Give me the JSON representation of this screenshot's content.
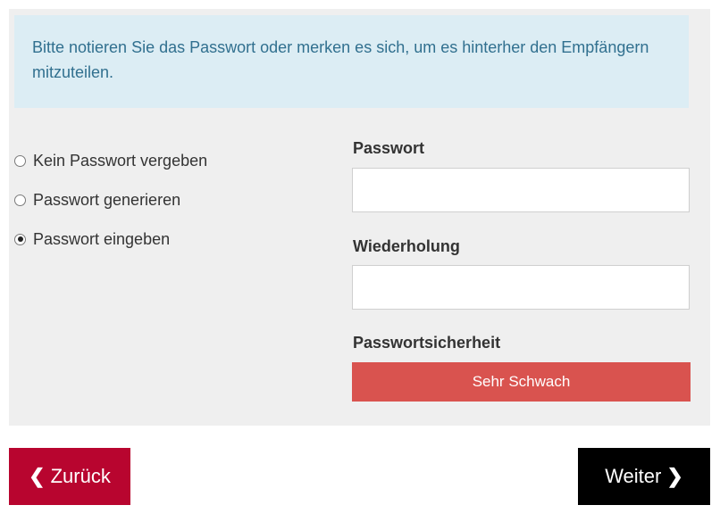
{
  "info": {
    "text": "Bitte notieren Sie das Passwort oder merken es sich, um es hinterher den Empfängern mitzuteilen."
  },
  "options": [
    {
      "label": "Kein Passwort vergeben",
      "checked": false
    },
    {
      "label": "Passwort generieren",
      "checked": false
    },
    {
      "label": "Passwort eingeben",
      "checked": true
    }
  ],
  "password": {
    "label": "Passwort",
    "value": ""
  },
  "repeat": {
    "label": "Wiederholung",
    "value": ""
  },
  "strength": {
    "label": "Passwortsicherheit",
    "value": "Sehr Schwach",
    "color": "#d9534f"
  },
  "buttons": {
    "back": {
      "label": "Zurück",
      "icon": "chevron-left-icon",
      "color": "#b8052f"
    },
    "next": {
      "label": "Weiter",
      "icon": "chevron-right-icon",
      "color": "#000000"
    }
  }
}
